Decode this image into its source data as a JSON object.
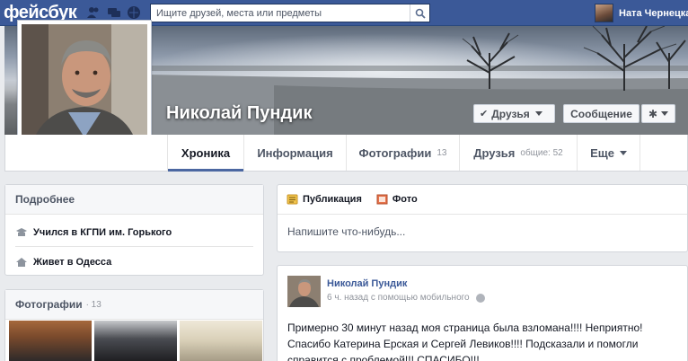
{
  "topbar": {
    "logo": "фейсбук",
    "search_placeholder": "Ищите друзей, места или предметы",
    "user_name": "Ната Чернецка",
    "icons": [
      "friend-requests-icon",
      "messages-icon",
      "notifications-icon",
      "search-icon"
    ]
  },
  "profile": {
    "name": "Николай Пундик",
    "friends_button": "Друзья",
    "message_button": "Сообщение"
  },
  "tabs": [
    {
      "label": "Хроника",
      "count": ""
    },
    {
      "label": "Информация",
      "count": ""
    },
    {
      "label": "Фотографии",
      "count": "13"
    },
    {
      "label": "Друзья",
      "count": "общие: 52"
    },
    {
      "label": "Еще",
      "count": ""
    }
  ],
  "about": {
    "title": "Подробнее",
    "items": [
      {
        "text": "Учился в КГПИ им. Горького",
        "icon": "education-icon"
      },
      {
        "text": "Живет в Одесса",
        "icon": "home-icon"
      }
    ]
  },
  "photos_card": {
    "title": "Фотографии",
    "count": "· 13"
  },
  "composer": {
    "publish_label": "Публикация",
    "photo_label": "Фото",
    "placeholder": "Напишите что-нибудь..."
  },
  "post": {
    "author": "Николай Пундик",
    "meta": "6 ч. назад с помощью мобильного",
    "text": "Примерно 30 минут назад моя страница была взломана!!!! Неприятно! Спасибо Катерина Ерская и Сергей Левиков!!!! Подсказали и помогли справится с проблемой!!! СПАСИБО!!!"
  },
  "colors": {
    "brand_blue": "#3b5998",
    "background": "#e9ebee",
    "link_blue": "#3b5998"
  }
}
